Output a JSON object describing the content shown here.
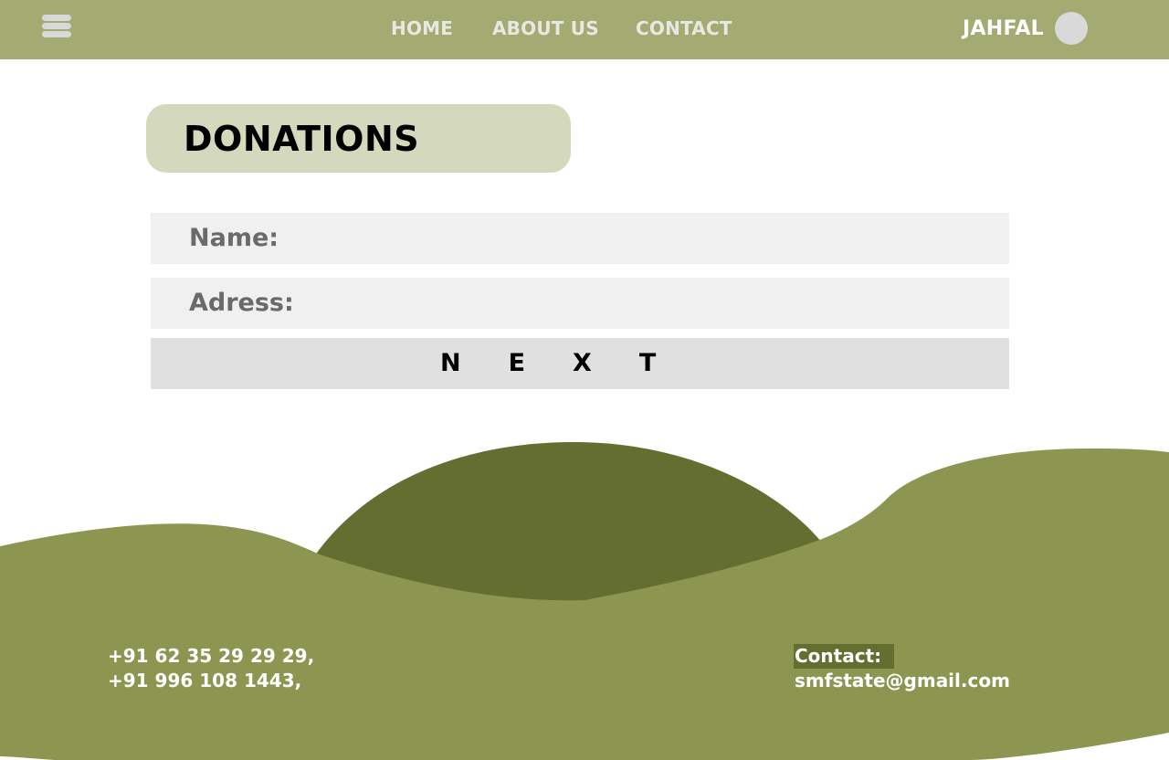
{
  "header": {
    "menu_icon": "hamburger-menu-icon",
    "nav": {
      "home": "HOME",
      "about": "ABOUT US",
      "contact": "CONTACT"
    },
    "user_name": "JAHFAL",
    "avatar_icon": "avatar-circle"
  },
  "main": {
    "title": "DONATIONS",
    "form": {
      "name_label": "Name:",
      "address_label": "Adress:",
      "next_label": "NEXT"
    }
  },
  "footer": {
    "phones": [
      "+91 62 35 29 29 29,",
      "+91 996 108 1443,"
    ],
    "contact_heading": "Contact:",
    "email": "smfstate@gmail.com"
  },
  "colors": {
    "header_bg": "#a3ab72",
    "title_pill_bg": "#d4d8bd",
    "field_bg": "#f0f0f0",
    "button_bg": "#e0e0e0",
    "footer_light": "#8c9651",
    "footer_dark": "#646e30"
  }
}
